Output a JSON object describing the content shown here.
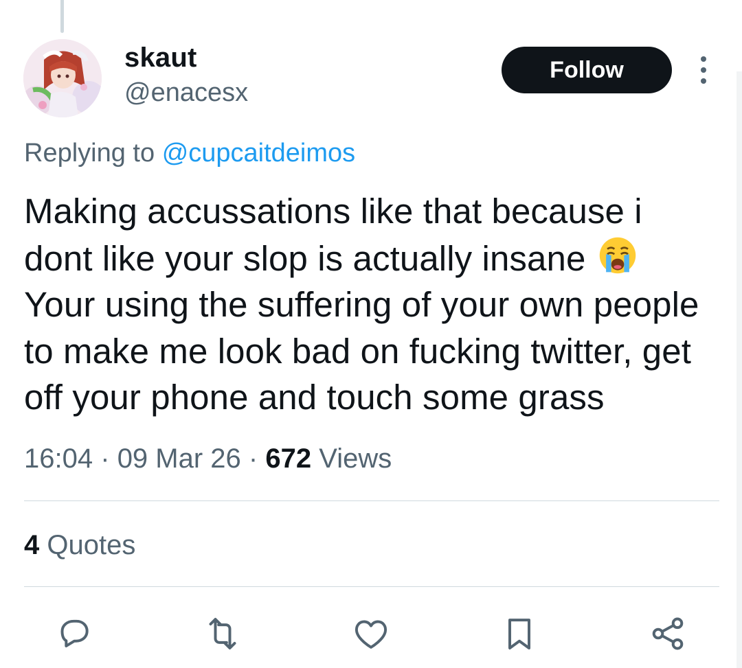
{
  "tweet": {
    "author": {
      "name": "skaut",
      "handle": "@enacesx"
    },
    "follow_label": "Follow",
    "more_icon": "more-vertical-icon",
    "replying_prefix": "Replying to",
    "replying_to": "@cupcaitdeimos",
    "text_lines": [
      "Making accussations like that because i",
      "dont like your slop is actually insane",
      "Your using the suffering of your own people",
      "to make me look bad on fucking twitter, get",
      "off your phone and touch some grass"
    ],
    "emoji": "loudly-crying-face-emoji",
    "time": "16:04",
    "date": "09 Mar 26",
    "separator": "·",
    "views_count": "672",
    "views_label": "Views",
    "quotes_count": "4",
    "quotes_label": "Quotes"
  },
  "actions": [
    {
      "name": "reply",
      "icon": "reply-icon"
    },
    {
      "name": "retweet",
      "icon": "retweet-icon"
    },
    {
      "name": "like",
      "icon": "heart-icon"
    },
    {
      "name": "bookmark",
      "icon": "bookmark-icon"
    },
    {
      "name": "share",
      "icon": "share-icon"
    }
  ],
  "colors": {
    "text": "#0f1419",
    "secondary": "#536471",
    "link": "#1d9bf0",
    "divider": "#cfd9de",
    "follow_bg": "#0f1419"
  }
}
